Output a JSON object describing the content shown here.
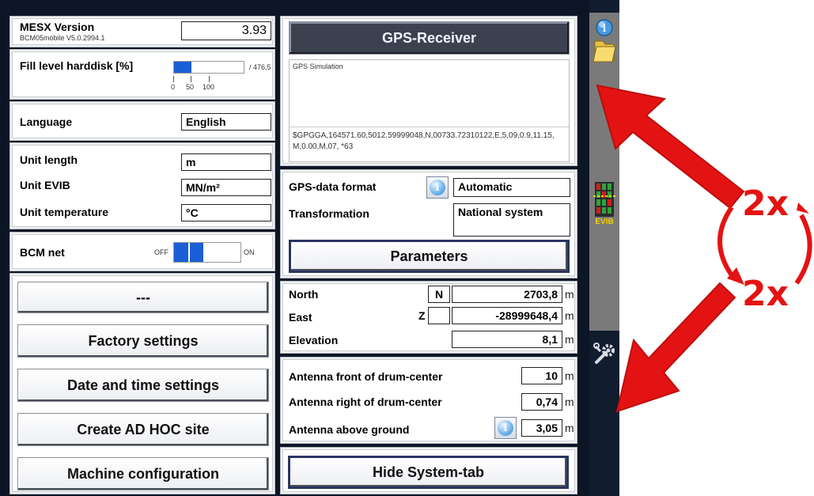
{
  "left_column": {
    "mesx": {
      "title": "MESX Version",
      "build": "BCM05mobile V5.0.2994.1",
      "value": "3.93"
    },
    "harddisk": {
      "label": "Fill level harddisk [%]",
      "total": "/ 476,5",
      "ticks": [
        "0",
        "50",
        "100"
      ],
      "fill_percent": 50
    },
    "language": {
      "label": "Language",
      "value": "English"
    },
    "units": {
      "length_label": "Unit length",
      "length_value": "m",
      "evib_label": "Unit EVIB",
      "evib_value": "MN/m²",
      "temp_label": "Unit temperature",
      "temp_value": "°C"
    },
    "bcm_net": {
      "label": "BCM net",
      "off": "OFF",
      "on": "ON",
      "state": "OFF"
    },
    "buttons": {
      "dashes": "---",
      "factory": "Factory settings",
      "datetime": "Date and time settings",
      "adhoc": "Create AD HOC site",
      "machine": "Machine configuration"
    }
  },
  "right_column": {
    "gps_receiver": {
      "title": "GPS-Receiver",
      "source": "GPS Simulation",
      "nmea_line1": "$GPGGA,164571.60,5012.59999048,N,00733.72310122,E,5,09,0.9,11.15,",
      "nmea_line2": "M,0.00,M,07,   *63"
    },
    "gps_format": {
      "label": "GPS-data format",
      "value": "Automatic"
    },
    "transformation": {
      "label": "Transformation",
      "value": "National system"
    },
    "parameters_button": "Parameters",
    "coords": {
      "north_label": "North",
      "north_letter": "N",
      "north_value": "2703,8",
      "north_unit": "m",
      "east_label": "East",
      "east_letter": "Z",
      "east_value": "-28999648,4",
      "east_unit": "m",
      "elev_label": "Elevation",
      "elev_value": "8,1",
      "elev_unit": "m"
    },
    "antenna": {
      "front_label": "Antenna front of drum-center",
      "front_value": "10",
      "front_unit": "m",
      "right_label": "Antenna right of drum-center",
      "right_value": "0,74",
      "right_unit": "m",
      "above_label": "Antenna above ground",
      "above_value": "3,05",
      "above_unit": "m"
    },
    "hide_button": "Hide System-tab"
  },
  "sidebar": {
    "icons": [
      "info-folder-icon",
      "evib-icon",
      "settings-tools-icon"
    ],
    "evib_label": "EVIB"
  },
  "annotation": {
    "top": "2x",
    "bottom": "2x",
    "color": "#e41313"
  }
}
